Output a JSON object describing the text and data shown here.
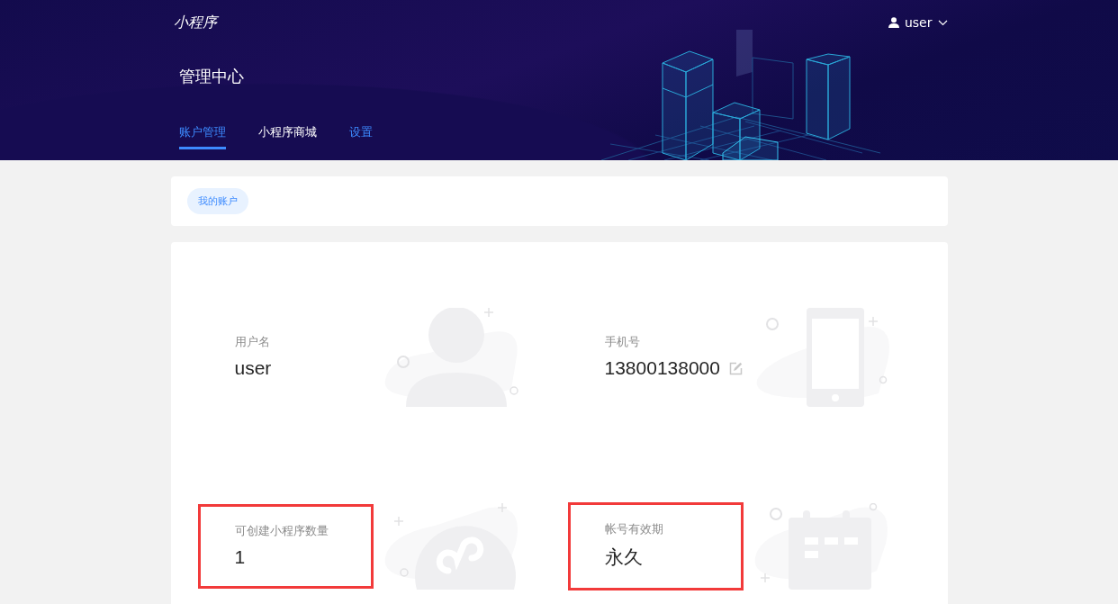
{
  "header": {
    "logo": "小程序",
    "user": "user",
    "title": "管理中心"
  },
  "tabs": [
    {
      "label": "账户管理",
      "selected": true
    },
    {
      "label": "小程序商城",
      "selected": false
    },
    {
      "label": "设置",
      "selected": false
    }
  ],
  "breadcrumb": {
    "label": "我的账户"
  },
  "fields": [
    {
      "label": "用户名",
      "value": "user",
      "kind": "person",
      "editable": false,
      "highlighted": false
    },
    {
      "label": "手机号",
      "value": "13800138000",
      "kind": "phone",
      "editable": true,
      "highlighted": false
    },
    {
      "label": "可创建小程序数量",
      "value": "1",
      "kind": "logo",
      "editable": false,
      "highlighted": true
    },
    {
      "label": "帐号有效期",
      "value": "永久",
      "kind": "calendar",
      "editable": false,
      "highlighted": true
    }
  ]
}
